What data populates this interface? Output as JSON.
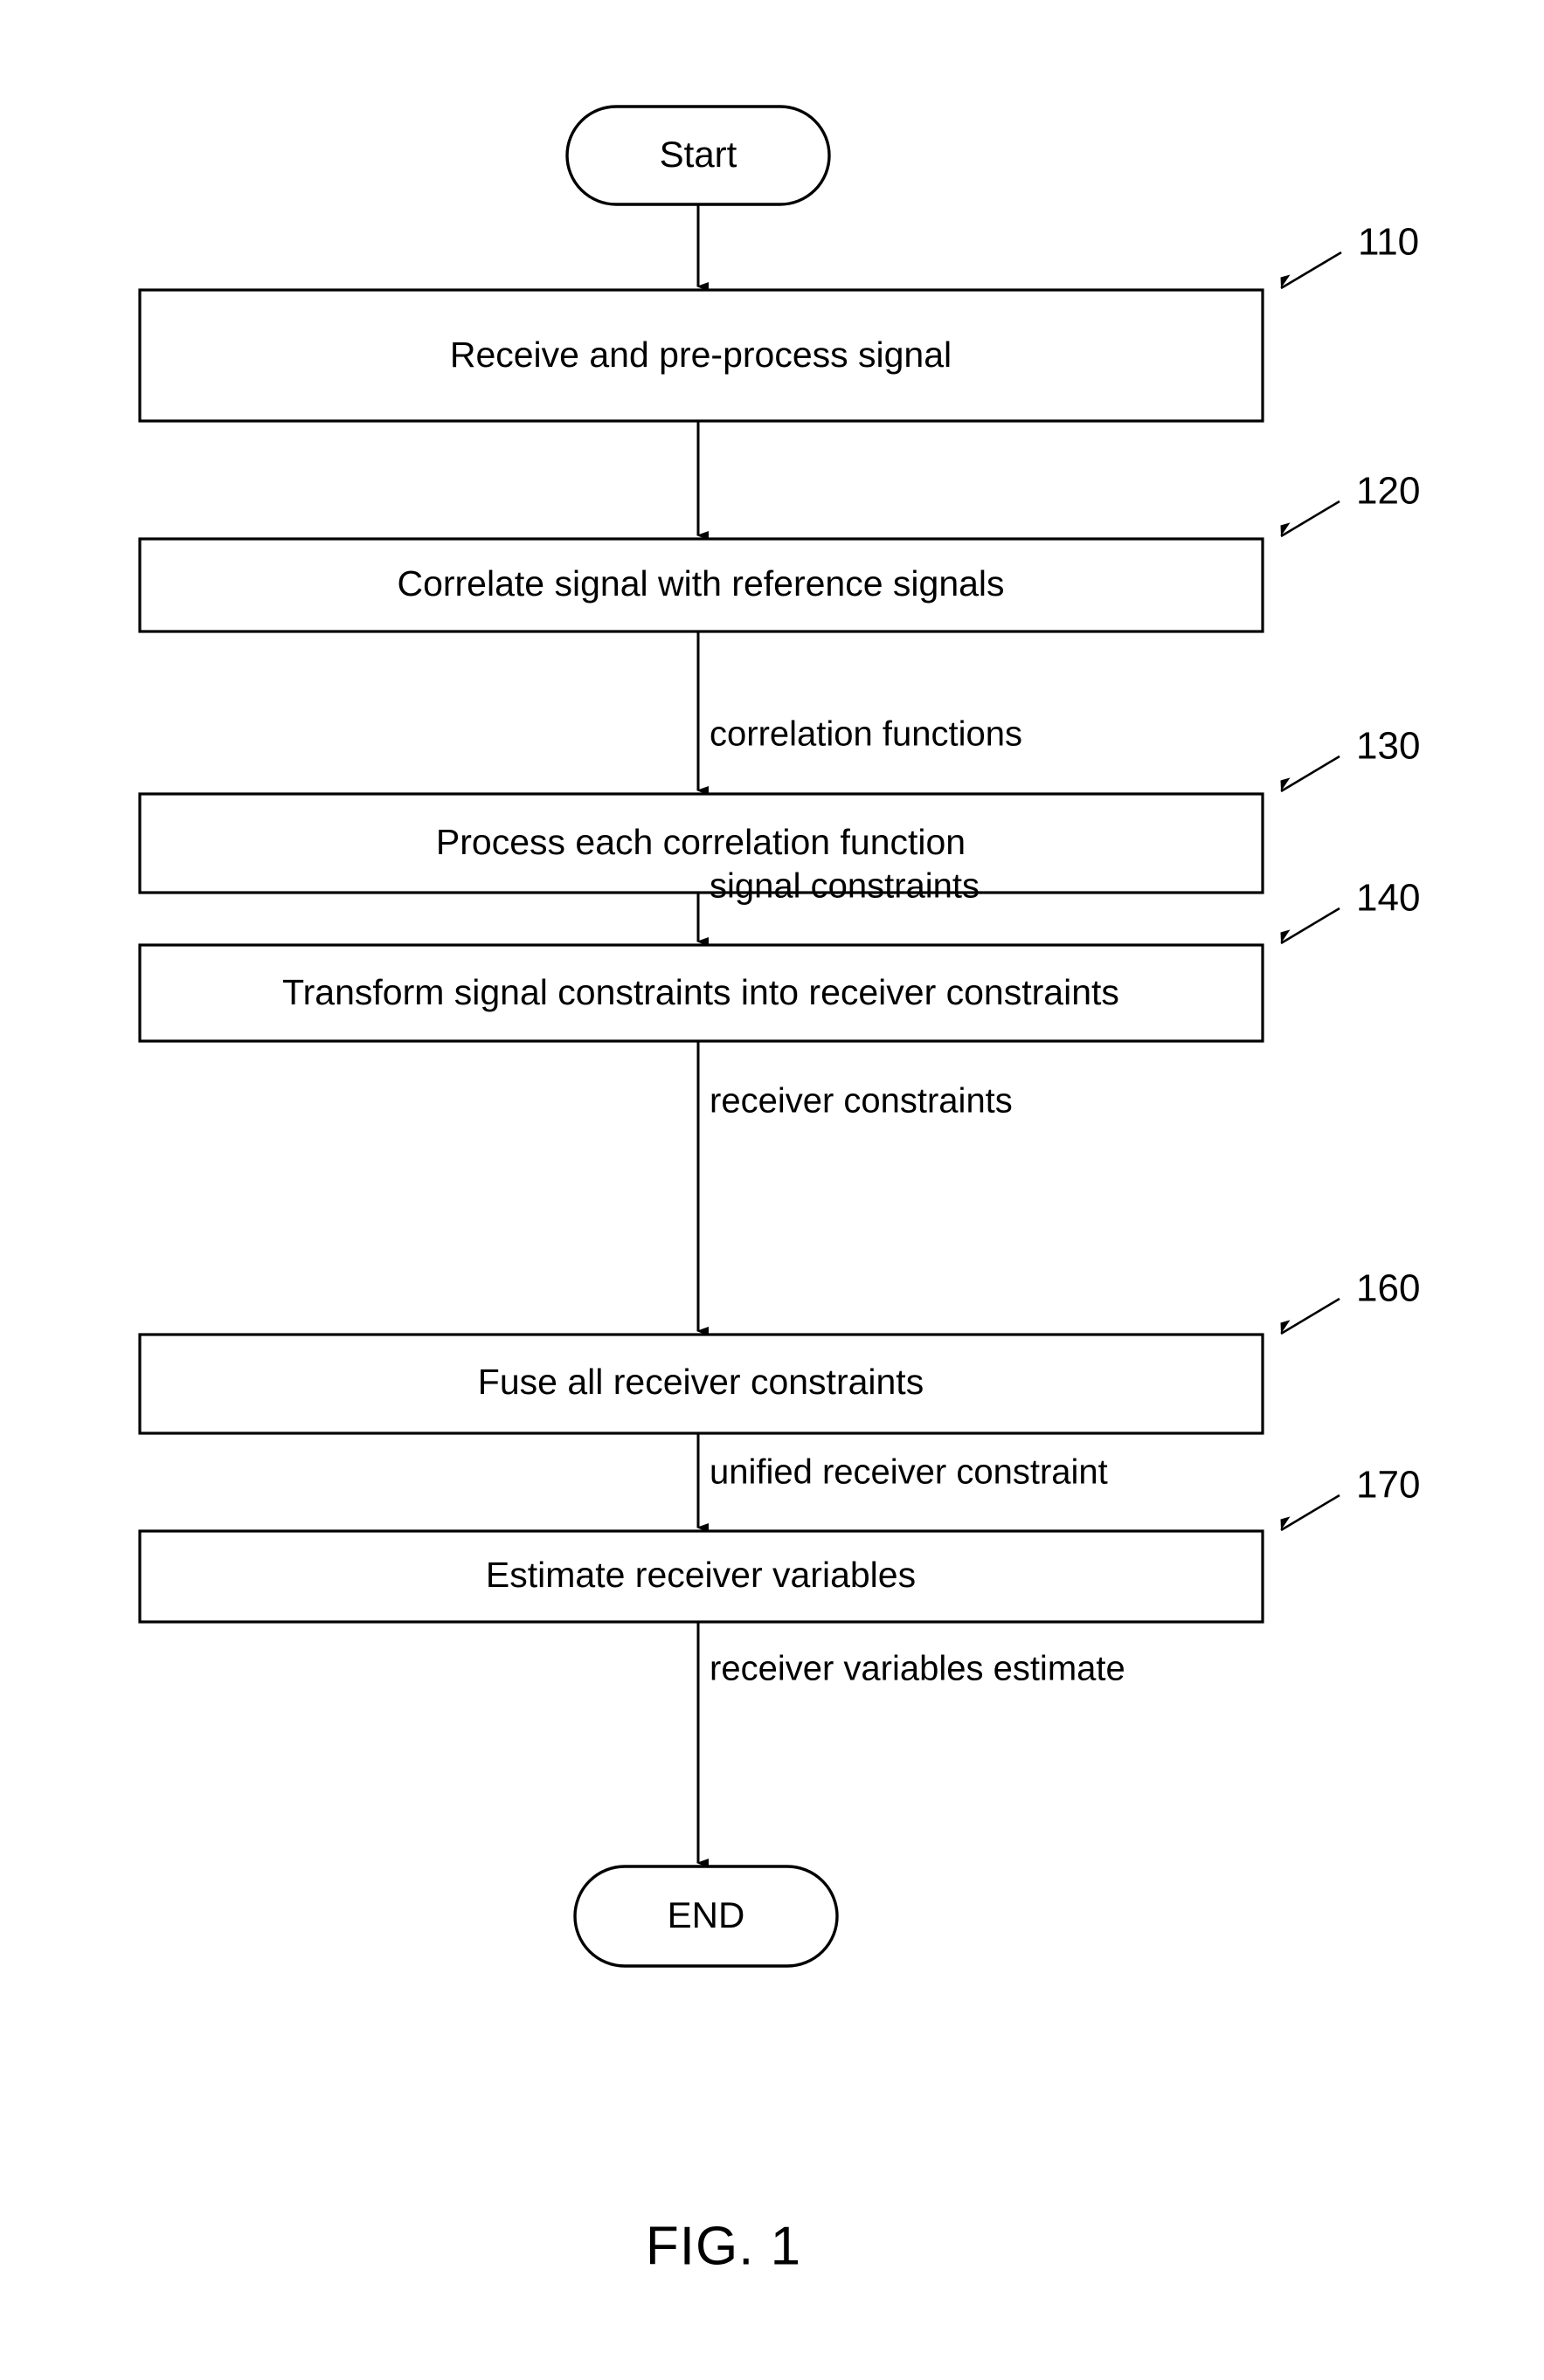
{
  "figure": {
    "caption": "FIG. 1"
  },
  "diagram": {
    "type": "flowchart",
    "orientation": "top-to-bottom",
    "start_terminal": {
      "label": "Start",
      "shape": "stadium"
    },
    "end_terminal": {
      "label": "END",
      "shape": "stadium"
    },
    "steps": [
      {
        "ref": "110",
        "label": "Receive and pre-process signal",
        "output_label": ""
      },
      {
        "ref": "120",
        "label": "Correlate signal with reference signals",
        "output_label": "correlation functions"
      },
      {
        "ref": "130",
        "label": "Process each correlation function",
        "output_label": "signal constraints"
      },
      {
        "ref": "140",
        "label": "Transform signal constraints into receiver constraints",
        "output_label": "receiver constraints"
      },
      {
        "ref": "160",
        "label": "Fuse all receiver constraints",
        "output_label": "unified receiver constraint"
      },
      {
        "ref": "170",
        "label": "Estimate receiver variables",
        "output_label": "receiver variables estimate"
      }
    ]
  },
  "colors": {
    "ink": "#000000",
    "paper": "#ffffff"
  }
}
